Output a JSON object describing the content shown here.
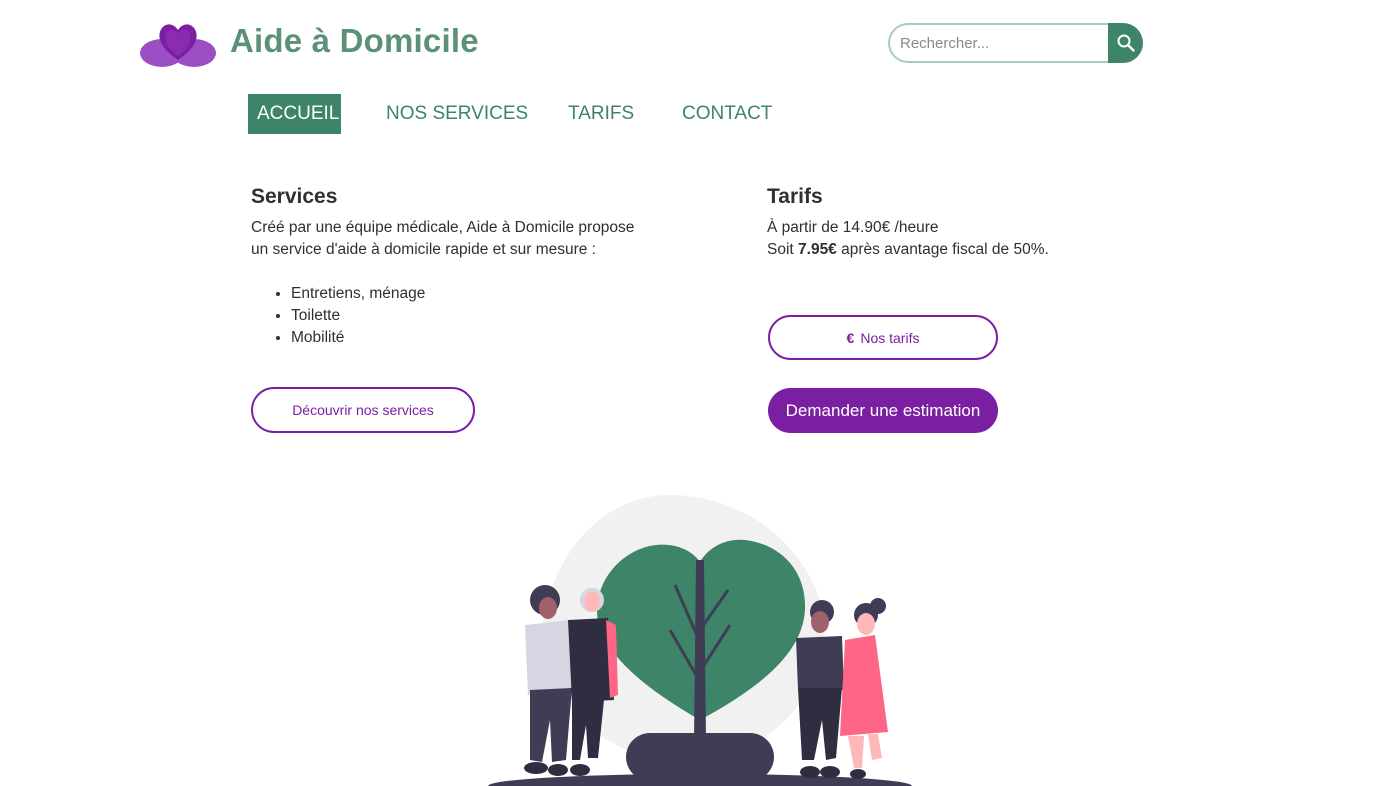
{
  "header": {
    "brand": "Aide à Domicile",
    "logo_icon": "heart-hands-icon",
    "search": {
      "placeholder": "Rechercher...",
      "value": ""
    },
    "search_icon": "search-icon"
  },
  "nav": {
    "items": [
      {
        "label": "ACCUEIL",
        "active": true
      },
      {
        "label": "NOS SERVICES",
        "active": false
      },
      {
        "label": "TARIFS",
        "active": false
      },
      {
        "label": "CONTACT",
        "active": false
      }
    ]
  },
  "services": {
    "title": "Services",
    "intro": "Créé par une équipe médicale, Aide à Domicile propose un service d'aide à domicile rapide et sur mesure :",
    "items": [
      "Entretiens, ménage",
      "Toilette",
      "Mobilité"
    ],
    "button_label": "Découvrir nos services"
  },
  "tarifs": {
    "title": "Tarifs",
    "line1": "À partir de 14.90€ /heure",
    "line2_prefix": "Soit ",
    "line2_price": "7.95€",
    "line2_suffix": " après avantage fiscal de 50%.",
    "button_tarifs_label": "Nos tarifs",
    "button_tarifs_icon": "euro-icon",
    "button_estimation_label": "Demander une estimation"
  },
  "illustration": {
    "icon": "people-heart-tree-illustration"
  },
  "colors": {
    "green": "#3d8468",
    "brand_green": "#5c9178",
    "purple": "#7b1fa2",
    "heart_purple": "#9c4fc2"
  }
}
